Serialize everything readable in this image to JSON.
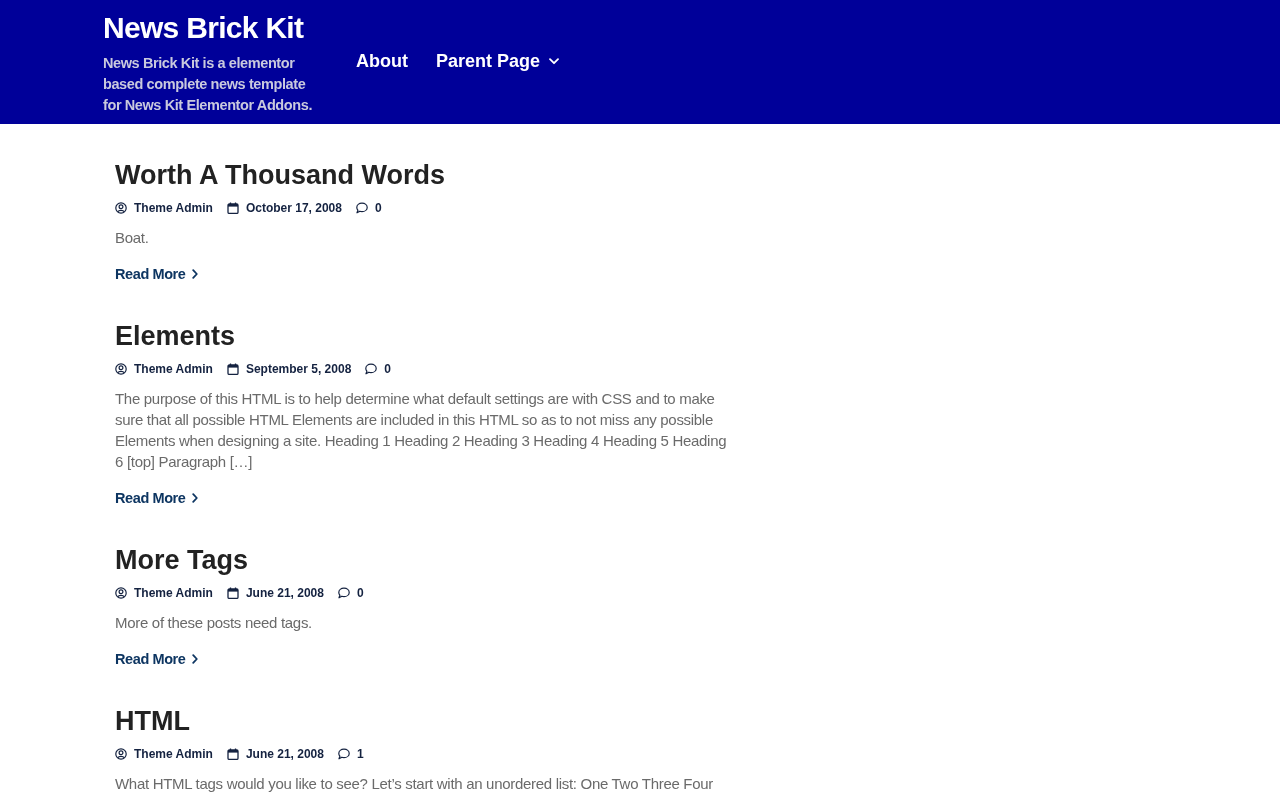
{
  "site": {
    "title": "News Brick Kit",
    "tagline": "News Brick Kit is a elementor based complete news template for News Kit Elementor Addons."
  },
  "nav": [
    {
      "label": "About",
      "has_submenu": false
    },
    {
      "label": "Parent Page",
      "has_submenu": true
    }
  ],
  "posts": [
    {
      "title": "Worth A Thousand Words",
      "author": "Theme Admin",
      "date": "October 17, 2008",
      "comments": "0",
      "excerpt": "Boat.",
      "read_more": "Read More"
    },
    {
      "title": "Elements",
      "author": "Theme Admin",
      "date": "September 5, 2008",
      "comments": "0",
      "excerpt": "The purpose of this HTML is to help determine what default settings are with CSS and to make sure that all possible HTML Elements are included in this HTML so as to not miss any possible Elements when designing a site. Heading 1 Heading 2 Heading 3 Heading 4 Heading 5 Heading 6 [top] Paragraph […]",
      "read_more": "Read More"
    },
    {
      "title": "More Tags",
      "author": "Theme Admin",
      "date": "June 21, 2008",
      "comments": "0",
      "excerpt": "More of these posts need tags.",
      "read_more": "Read More"
    },
    {
      "title": "HTML",
      "author": "Theme Admin",
      "date": "June 21, 2008",
      "comments": "1",
      "excerpt": "What HTML tags would you like to see? Let’s start with an unordered list: One Two Three Four"
    }
  ]
}
